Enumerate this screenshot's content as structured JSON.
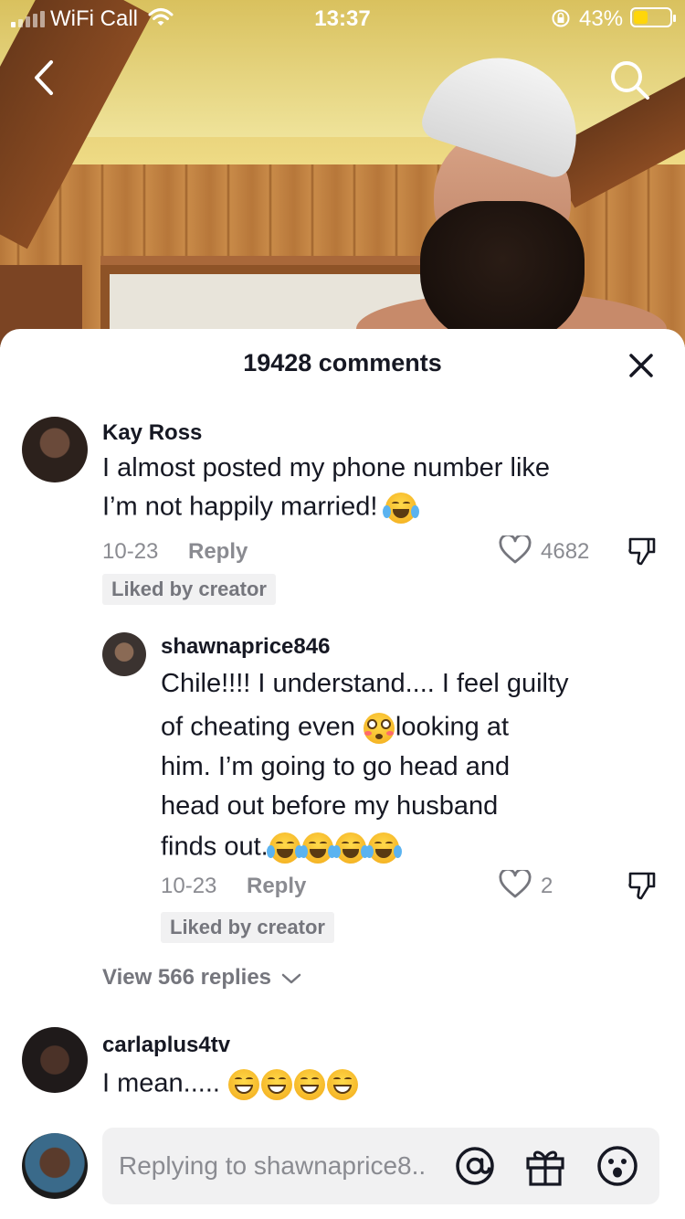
{
  "status_bar": {
    "carrier": "WiFi Call",
    "time": "13:37",
    "battery_percent": "43%",
    "battery_level": 0.4,
    "signal_bars_on": 1
  },
  "top_nav": {
    "back_icon": "chevron-left-icon",
    "search_icon": "search-icon"
  },
  "sheet": {
    "title": "19428 comments",
    "close_icon": "close-icon"
  },
  "comments": [
    {
      "username": "Kay Ross",
      "text_lines": [
        "I almost posted my phone number like",
        "I’m not happily married!"
      ],
      "emoji_tail": [
        "face-with-tears-of-joy"
      ],
      "date": "10-23",
      "reply_label": "Reply",
      "likes": "4682",
      "liked_by_creator": "Liked by creator"
    },
    {
      "username": "shawnaprice846",
      "text_lines": [
        "Chile!!!! I understand.... I feel guilty",
        "of cheating even",
        "looking at",
        "him. I’m going to go head and",
        "head out before my husband",
        "finds out."
      ],
      "emoji_tail": [
        "flushed-face",
        "face-with-tears-of-joy x4"
      ],
      "date": "10-23",
      "reply_label": "Reply",
      "likes": "2",
      "liked_by_creator": "Liked by creator"
    },
    {
      "username": "carlaplus4tv",
      "text_lines": [
        "I mean....."
      ],
      "emoji_tail": [
        "grinning-face x4"
      ]
    }
  ],
  "view_replies": "View 566 replies",
  "reply_bar": {
    "placeholder": "Replying to shawnaprice8..",
    "icons": [
      "at-icon",
      "gift-icon",
      "emoji-icon"
    ]
  }
}
